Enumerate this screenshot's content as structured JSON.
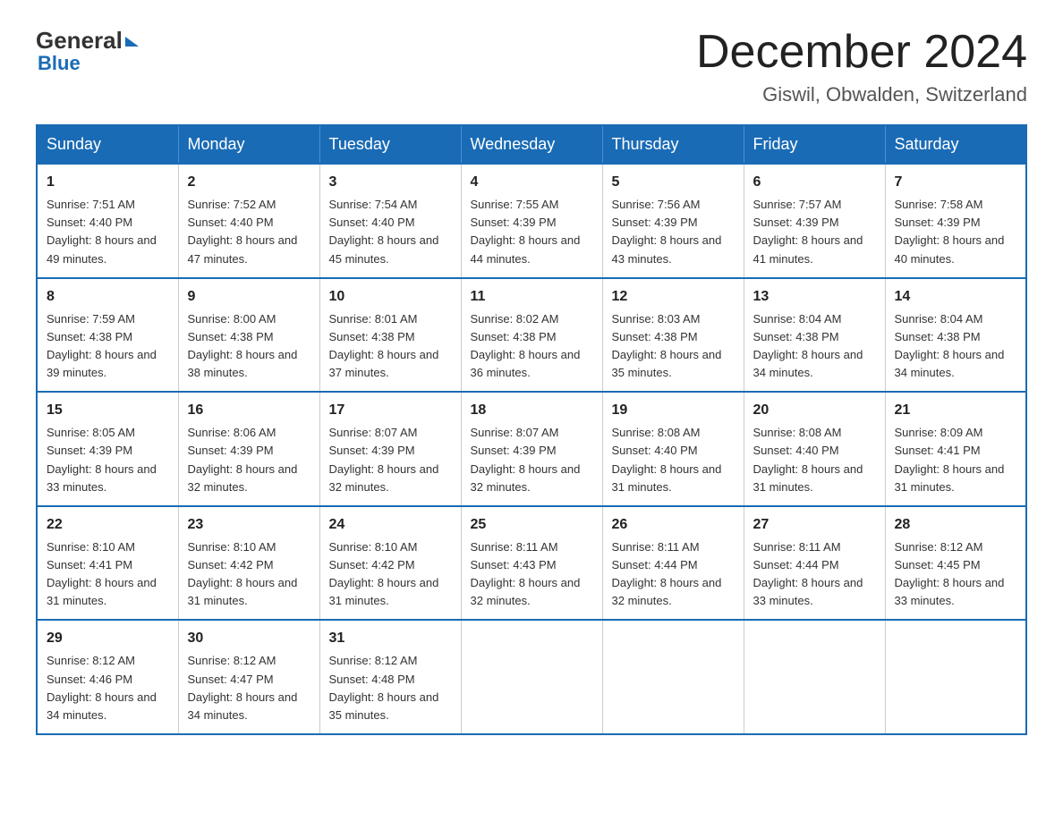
{
  "header": {
    "logo_general": "General",
    "logo_blue": "Blue",
    "month_title": "December 2024",
    "subtitle": "Giswil, Obwalden, Switzerland"
  },
  "weekdays": [
    "Sunday",
    "Monday",
    "Tuesday",
    "Wednesday",
    "Thursday",
    "Friday",
    "Saturday"
  ],
  "weeks": [
    [
      {
        "day": "1",
        "sunrise": "Sunrise: 7:51 AM",
        "sunset": "Sunset: 4:40 PM",
        "daylight": "Daylight: 8 hours and 49 minutes."
      },
      {
        "day": "2",
        "sunrise": "Sunrise: 7:52 AM",
        "sunset": "Sunset: 4:40 PM",
        "daylight": "Daylight: 8 hours and 47 minutes."
      },
      {
        "day": "3",
        "sunrise": "Sunrise: 7:54 AM",
        "sunset": "Sunset: 4:40 PM",
        "daylight": "Daylight: 8 hours and 45 minutes."
      },
      {
        "day": "4",
        "sunrise": "Sunrise: 7:55 AM",
        "sunset": "Sunset: 4:39 PM",
        "daylight": "Daylight: 8 hours and 44 minutes."
      },
      {
        "day": "5",
        "sunrise": "Sunrise: 7:56 AM",
        "sunset": "Sunset: 4:39 PM",
        "daylight": "Daylight: 8 hours and 43 minutes."
      },
      {
        "day": "6",
        "sunrise": "Sunrise: 7:57 AM",
        "sunset": "Sunset: 4:39 PM",
        "daylight": "Daylight: 8 hours and 41 minutes."
      },
      {
        "day": "7",
        "sunrise": "Sunrise: 7:58 AM",
        "sunset": "Sunset: 4:39 PM",
        "daylight": "Daylight: 8 hours and 40 minutes."
      }
    ],
    [
      {
        "day": "8",
        "sunrise": "Sunrise: 7:59 AM",
        "sunset": "Sunset: 4:38 PM",
        "daylight": "Daylight: 8 hours and 39 minutes."
      },
      {
        "day": "9",
        "sunrise": "Sunrise: 8:00 AM",
        "sunset": "Sunset: 4:38 PM",
        "daylight": "Daylight: 8 hours and 38 minutes."
      },
      {
        "day": "10",
        "sunrise": "Sunrise: 8:01 AM",
        "sunset": "Sunset: 4:38 PM",
        "daylight": "Daylight: 8 hours and 37 minutes."
      },
      {
        "day": "11",
        "sunrise": "Sunrise: 8:02 AM",
        "sunset": "Sunset: 4:38 PM",
        "daylight": "Daylight: 8 hours and 36 minutes."
      },
      {
        "day": "12",
        "sunrise": "Sunrise: 8:03 AM",
        "sunset": "Sunset: 4:38 PM",
        "daylight": "Daylight: 8 hours and 35 minutes."
      },
      {
        "day": "13",
        "sunrise": "Sunrise: 8:04 AM",
        "sunset": "Sunset: 4:38 PM",
        "daylight": "Daylight: 8 hours and 34 minutes."
      },
      {
        "day": "14",
        "sunrise": "Sunrise: 8:04 AM",
        "sunset": "Sunset: 4:38 PM",
        "daylight": "Daylight: 8 hours and 34 minutes."
      }
    ],
    [
      {
        "day": "15",
        "sunrise": "Sunrise: 8:05 AM",
        "sunset": "Sunset: 4:39 PM",
        "daylight": "Daylight: 8 hours and 33 minutes."
      },
      {
        "day": "16",
        "sunrise": "Sunrise: 8:06 AM",
        "sunset": "Sunset: 4:39 PM",
        "daylight": "Daylight: 8 hours and 32 minutes."
      },
      {
        "day": "17",
        "sunrise": "Sunrise: 8:07 AM",
        "sunset": "Sunset: 4:39 PM",
        "daylight": "Daylight: 8 hours and 32 minutes."
      },
      {
        "day": "18",
        "sunrise": "Sunrise: 8:07 AM",
        "sunset": "Sunset: 4:39 PM",
        "daylight": "Daylight: 8 hours and 32 minutes."
      },
      {
        "day": "19",
        "sunrise": "Sunrise: 8:08 AM",
        "sunset": "Sunset: 4:40 PM",
        "daylight": "Daylight: 8 hours and 31 minutes."
      },
      {
        "day": "20",
        "sunrise": "Sunrise: 8:08 AM",
        "sunset": "Sunset: 4:40 PM",
        "daylight": "Daylight: 8 hours and 31 minutes."
      },
      {
        "day": "21",
        "sunrise": "Sunrise: 8:09 AM",
        "sunset": "Sunset: 4:41 PM",
        "daylight": "Daylight: 8 hours and 31 minutes."
      }
    ],
    [
      {
        "day": "22",
        "sunrise": "Sunrise: 8:10 AM",
        "sunset": "Sunset: 4:41 PM",
        "daylight": "Daylight: 8 hours and 31 minutes."
      },
      {
        "day": "23",
        "sunrise": "Sunrise: 8:10 AM",
        "sunset": "Sunset: 4:42 PM",
        "daylight": "Daylight: 8 hours and 31 minutes."
      },
      {
        "day": "24",
        "sunrise": "Sunrise: 8:10 AM",
        "sunset": "Sunset: 4:42 PM",
        "daylight": "Daylight: 8 hours and 31 minutes."
      },
      {
        "day": "25",
        "sunrise": "Sunrise: 8:11 AM",
        "sunset": "Sunset: 4:43 PM",
        "daylight": "Daylight: 8 hours and 32 minutes."
      },
      {
        "day": "26",
        "sunrise": "Sunrise: 8:11 AM",
        "sunset": "Sunset: 4:44 PM",
        "daylight": "Daylight: 8 hours and 32 minutes."
      },
      {
        "day": "27",
        "sunrise": "Sunrise: 8:11 AM",
        "sunset": "Sunset: 4:44 PM",
        "daylight": "Daylight: 8 hours and 33 minutes."
      },
      {
        "day": "28",
        "sunrise": "Sunrise: 8:12 AM",
        "sunset": "Sunset: 4:45 PM",
        "daylight": "Daylight: 8 hours and 33 minutes."
      }
    ],
    [
      {
        "day": "29",
        "sunrise": "Sunrise: 8:12 AM",
        "sunset": "Sunset: 4:46 PM",
        "daylight": "Daylight: 8 hours and 34 minutes."
      },
      {
        "day": "30",
        "sunrise": "Sunrise: 8:12 AM",
        "sunset": "Sunset: 4:47 PM",
        "daylight": "Daylight: 8 hours and 34 minutes."
      },
      {
        "day": "31",
        "sunrise": "Sunrise: 8:12 AM",
        "sunset": "Sunset: 4:48 PM",
        "daylight": "Daylight: 8 hours and 35 minutes."
      },
      null,
      null,
      null,
      null
    ]
  ]
}
